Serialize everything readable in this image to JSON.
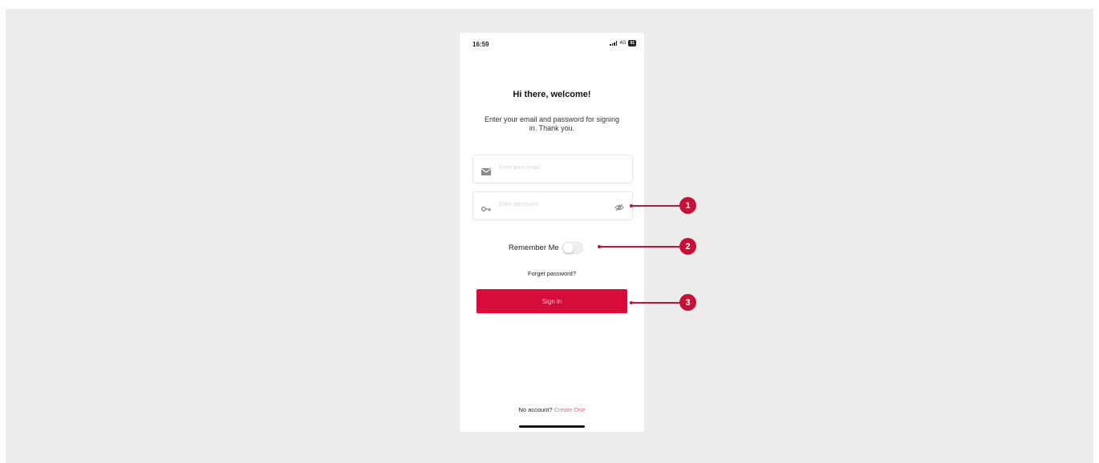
{
  "status_bar": {
    "time": "16:59",
    "network": "4G",
    "battery": "91"
  },
  "login": {
    "title": "Hi there, welcome!",
    "subtitle": "Enter your email and password for signing in. Thank you.",
    "email_placeholder": "Enter your email",
    "password_placeholder": "Enter password",
    "remember_label": "Remember Me",
    "remember_on": false,
    "forget_label": "Forget password?",
    "signin_label": "Sign in",
    "no_account_text": "No account?",
    "create_label": "Create One"
  },
  "callouts": [
    "1",
    "2",
    "3"
  ],
  "colors": {
    "accent": "#d80c3a",
    "callout": "#c80f35",
    "background": "#ececeb"
  },
  "icons": {
    "email": "mail-icon",
    "password": "key-icon",
    "visibility": "eye-off-icon"
  }
}
